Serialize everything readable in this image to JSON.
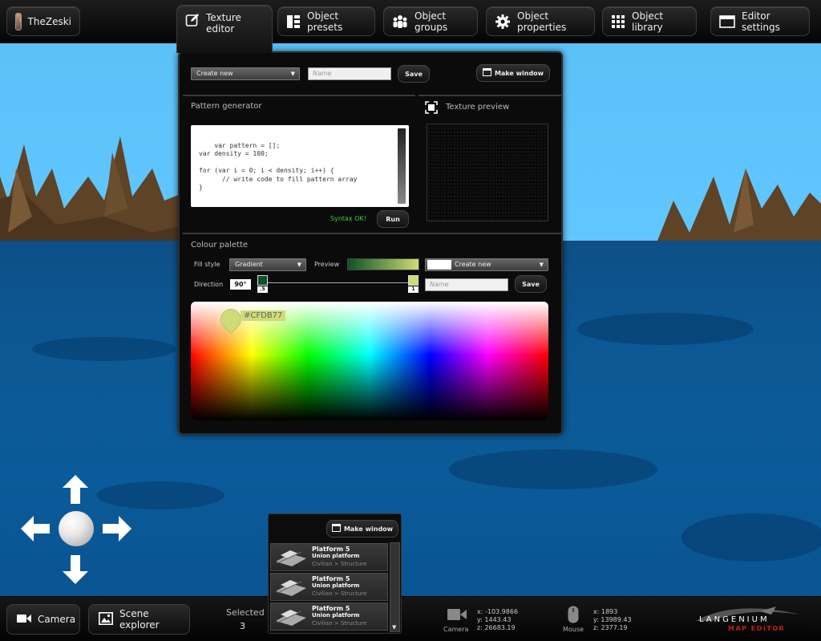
{
  "user": {
    "name": "TheZeski"
  },
  "topnav": {
    "texture_editor": "Texture editor",
    "object_presets": "Object presets",
    "object_groups": "Object groups",
    "object_properties": "Object properties",
    "object_library": "Object library",
    "editor_settings": "Editor settings"
  },
  "editor": {
    "texture_select": "Create new",
    "name_placeholder": "Name",
    "save_label": "Save",
    "make_window_label": "Make window",
    "pattern_generator_title": "Pattern generator",
    "texture_preview_title": "Texture preview",
    "code": "var pattern = [];\nvar density = 100;\n\nfor (var i = 0; i < density; i++) {\n      // write code to fill pattern array\n}",
    "syntax_status": "Syntax OK!",
    "run_label": "Run",
    "colour_palette_title": "Colour palette",
    "fill_style_label": "Fill style",
    "fill_style_value": "Gradient",
    "preview_label": "Preview",
    "palette_select": "Create new",
    "direction_label": "Direction",
    "direction_value": "90°",
    "stop_start_label": ".5",
    "stop_end_label": "1",
    "palette_name_placeholder": "Name",
    "palette_save_label": "Save",
    "picked_hex": "#CFDB77"
  },
  "colors": {
    "gradient_start": "#0f5127",
    "gradient_end": "#cfdb77",
    "syntax_ok": "#38d13a",
    "sky": "#5bc2f5",
    "sea": "#0b5a99"
  },
  "objlist": {
    "make_window_label": "Make window",
    "items": [
      {
        "name": "Platform 5",
        "type": "Union platform",
        "path": "Civilian > Structure"
      },
      {
        "name": "Platform 5",
        "type": "Union platform",
        "path": "Civilian > Structure"
      },
      {
        "name": "Platform 5",
        "type": "Union platform",
        "path": "Civilian > Structure"
      }
    ]
  },
  "bottombar": {
    "camera_label": "Camera",
    "scene_explorer_label": "Scene explorer",
    "selected_title": "Selected",
    "selected_count": "3",
    "camera_caption": "Camera",
    "camera_x": "x: -103.9866",
    "camera_y": "y: 1443.43",
    "camera_z": "z: 26683.19",
    "mouse_caption": "Mouse",
    "mouse_x": "x: 1893",
    "mouse_y": "y: 13989.43",
    "mouse_z": "z: 2377.19",
    "logo_line1": "LANGENIUM",
    "logo_line2": "MAP EDITOR"
  },
  "icons": [
    "edit-icon",
    "presets-icon",
    "groups-icon",
    "gear-icon",
    "library-icon",
    "window-icon",
    "camera-icon",
    "image-icon",
    "mouse-icon",
    "arrow-up-icon",
    "arrow-down-icon",
    "arrow-left-icon",
    "arrow-right-icon",
    "expand-icon"
  ]
}
